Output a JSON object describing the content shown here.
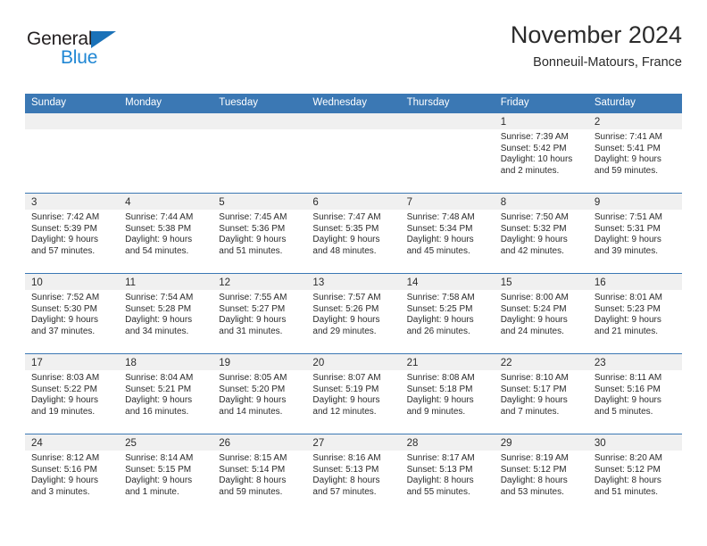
{
  "brand": {
    "name_part1": "General",
    "name_part2": "Blue",
    "triangle_color": "#1b72b8",
    "blue_color": "#2087d4"
  },
  "header": {
    "title": "November 2024",
    "subtitle": "Bonneuil-Matours, France"
  },
  "theme": {
    "header_bg": "#3b78b4",
    "daynum_bg": "#f0f0f0",
    "text": "#2b2b2b"
  },
  "weekdays": [
    "Sunday",
    "Monday",
    "Tuesday",
    "Wednesday",
    "Thursday",
    "Friday",
    "Saturday"
  ],
  "labels": {
    "sunrise_prefix": "Sunrise:",
    "sunset_prefix": "Sunset:",
    "daylight_prefix": "Daylight:"
  },
  "weeks": [
    [
      {
        "day": "",
        "blank": true
      },
      {
        "day": "",
        "blank": true
      },
      {
        "day": "",
        "blank": true
      },
      {
        "day": "",
        "blank": true
      },
      {
        "day": "",
        "blank": true
      },
      {
        "day": "1",
        "sunrise": "Sunrise: 7:39 AM",
        "sunset": "Sunset: 5:42 PM",
        "daylight_line1": "Daylight: 10 hours",
        "daylight_line2": "and 2 minutes."
      },
      {
        "day": "2",
        "sunrise": "Sunrise: 7:41 AM",
        "sunset": "Sunset: 5:41 PM",
        "daylight_line1": "Daylight: 9 hours",
        "daylight_line2": "and 59 minutes."
      }
    ],
    [
      {
        "day": "3",
        "sunrise": "Sunrise: 7:42 AM",
        "sunset": "Sunset: 5:39 PM",
        "daylight_line1": "Daylight: 9 hours",
        "daylight_line2": "and 57 minutes."
      },
      {
        "day": "4",
        "sunrise": "Sunrise: 7:44 AM",
        "sunset": "Sunset: 5:38 PM",
        "daylight_line1": "Daylight: 9 hours",
        "daylight_line2": "and 54 minutes."
      },
      {
        "day": "5",
        "sunrise": "Sunrise: 7:45 AM",
        "sunset": "Sunset: 5:36 PM",
        "daylight_line1": "Daylight: 9 hours",
        "daylight_line2": "and 51 minutes."
      },
      {
        "day": "6",
        "sunrise": "Sunrise: 7:47 AM",
        "sunset": "Sunset: 5:35 PM",
        "daylight_line1": "Daylight: 9 hours",
        "daylight_line2": "and 48 minutes."
      },
      {
        "day": "7",
        "sunrise": "Sunrise: 7:48 AM",
        "sunset": "Sunset: 5:34 PM",
        "daylight_line1": "Daylight: 9 hours",
        "daylight_line2": "and 45 minutes."
      },
      {
        "day": "8",
        "sunrise": "Sunrise: 7:50 AM",
        "sunset": "Sunset: 5:32 PM",
        "daylight_line1": "Daylight: 9 hours",
        "daylight_line2": "and 42 minutes."
      },
      {
        "day": "9",
        "sunrise": "Sunrise: 7:51 AM",
        "sunset": "Sunset: 5:31 PM",
        "daylight_line1": "Daylight: 9 hours",
        "daylight_line2": "and 39 minutes."
      }
    ],
    [
      {
        "day": "10",
        "sunrise": "Sunrise: 7:52 AM",
        "sunset": "Sunset: 5:30 PM",
        "daylight_line1": "Daylight: 9 hours",
        "daylight_line2": "and 37 minutes."
      },
      {
        "day": "11",
        "sunrise": "Sunrise: 7:54 AM",
        "sunset": "Sunset: 5:28 PM",
        "daylight_line1": "Daylight: 9 hours",
        "daylight_line2": "and 34 minutes."
      },
      {
        "day": "12",
        "sunrise": "Sunrise: 7:55 AM",
        "sunset": "Sunset: 5:27 PM",
        "daylight_line1": "Daylight: 9 hours",
        "daylight_line2": "and 31 minutes."
      },
      {
        "day": "13",
        "sunrise": "Sunrise: 7:57 AM",
        "sunset": "Sunset: 5:26 PM",
        "daylight_line1": "Daylight: 9 hours",
        "daylight_line2": "and 29 minutes."
      },
      {
        "day": "14",
        "sunrise": "Sunrise: 7:58 AM",
        "sunset": "Sunset: 5:25 PM",
        "daylight_line1": "Daylight: 9 hours",
        "daylight_line2": "and 26 minutes."
      },
      {
        "day": "15",
        "sunrise": "Sunrise: 8:00 AM",
        "sunset": "Sunset: 5:24 PM",
        "daylight_line1": "Daylight: 9 hours",
        "daylight_line2": "and 24 minutes."
      },
      {
        "day": "16",
        "sunrise": "Sunrise: 8:01 AM",
        "sunset": "Sunset: 5:23 PM",
        "daylight_line1": "Daylight: 9 hours",
        "daylight_line2": "and 21 minutes."
      }
    ],
    [
      {
        "day": "17",
        "sunrise": "Sunrise: 8:03 AM",
        "sunset": "Sunset: 5:22 PM",
        "daylight_line1": "Daylight: 9 hours",
        "daylight_line2": "and 19 minutes."
      },
      {
        "day": "18",
        "sunrise": "Sunrise: 8:04 AM",
        "sunset": "Sunset: 5:21 PM",
        "daylight_line1": "Daylight: 9 hours",
        "daylight_line2": "and 16 minutes."
      },
      {
        "day": "19",
        "sunrise": "Sunrise: 8:05 AM",
        "sunset": "Sunset: 5:20 PM",
        "daylight_line1": "Daylight: 9 hours",
        "daylight_line2": "and 14 minutes."
      },
      {
        "day": "20",
        "sunrise": "Sunrise: 8:07 AM",
        "sunset": "Sunset: 5:19 PM",
        "daylight_line1": "Daylight: 9 hours",
        "daylight_line2": "and 12 minutes."
      },
      {
        "day": "21",
        "sunrise": "Sunrise: 8:08 AM",
        "sunset": "Sunset: 5:18 PM",
        "daylight_line1": "Daylight: 9 hours",
        "daylight_line2": "and 9 minutes."
      },
      {
        "day": "22",
        "sunrise": "Sunrise: 8:10 AM",
        "sunset": "Sunset: 5:17 PM",
        "daylight_line1": "Daylight: 9 hours",
        "daylight_line2": "and 7 minutes."
      },
      {
        "day": "23",
        "sunrise": "Sunrise: 8:11 AM",
        "sunset": "Sunset: 5:16 PM",
        "daylight_line1": "Daylight: 9 hours",
        "daylight_line2": "and 5 minutes."
      }
    ],
    [
      {
        "day": "24",
        "sunrise": "Sunrise: 8:12 AM",
        "sunset": "Sunset: 5:16 PM",
        "daylight_line1": "Daylight: 9 hours",
        "daylight_line2": "and 3 minutes."
      },
      {
        "day": "25",
        "sunrise": "Sunrise: 8:14 AM",
        "sunset": "Sunset: 5:15 PM",
        "daylight_line1": "Daylight: 9 hours",
        "daylight_line2": "and 1 minute."
      },
      {
        "day": "26",
        "sunrise": "Sunrise: 8:15 AM",
        "sunset": "Sunset: 5:14 PM",
        "daylight_line1": "Daylight: 8 hours",
        "daylight_line2": "and 59 minutes."
      },
      {
        "day": "27",
        "sunrise": "Sunrise: 8:16 AM",
        "sunset": "Sunset: 5:13 PM",
        "daylight_line1": "Daylight: 8 hours",
        "daylight_line2": "and 57 minutes."
      },
      {
        "day": "28",
        "sunrise": "Sunrise: 8:17 AM",
        "sunset": "Sunset: 5:13 PM",
        "daylight_line1": "Daylight: 8 hours",
        "daylight_line2": "and 55 minutes."
      },
      {
        "day": "29",
        "sunrise": "Sunrise: 8:19 AM",
        "sunset": "Sunset: 5:12 PM",
        "daylight_line1": "Daylight: 8 hours",
        "daylight_line2": "and 53 minutes."
      },
      {
        "day": "30",
        "sunrise": "Sunrise: 8:20 AM",
        "sunset": "Sunset: 5:12 PM",
        "daylight_line1": "Daylight: 8 hours",
        "daylight_line2": "and 51 minutes."
      }
    ]
  ]
}
